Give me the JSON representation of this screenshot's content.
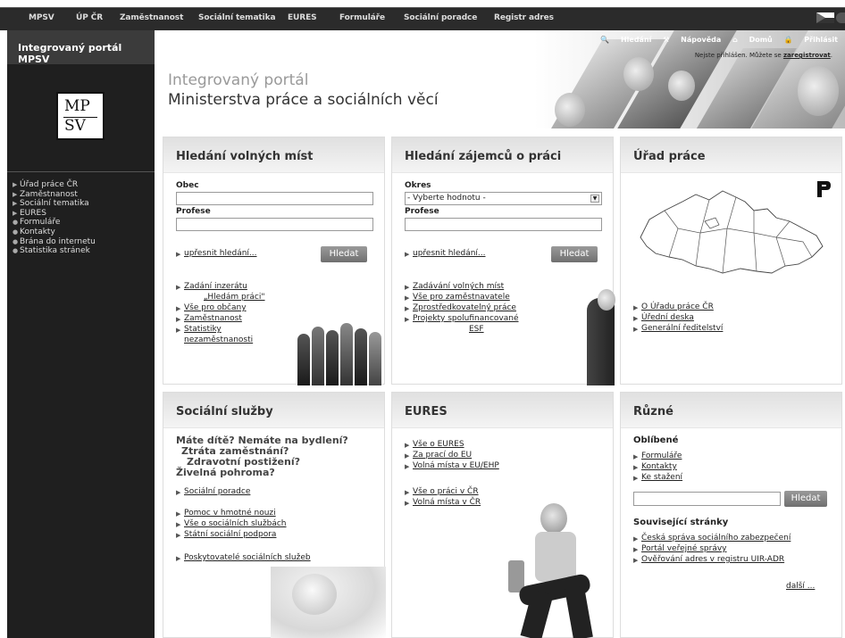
{
  "top_nav": [
    "MPSV",
    "ÚP ČR",
    "Zaměstnanost",
    "Sociální tematika",
    "EURES",
    "Formuláře",
    "Sociální poradce",
    "Registr adres"
  ],
  "sidebar": {
    "title": "Integrovaný portál MPSV",
    "logo_top": "MP",
    "logo_bottom": "SV",
    "menu": [
      "Úřad práce ČR",
      "Zaměstnanost",
      "Sociální tematika",
      "EURES",
      "Formuláře",
      "Kontakty",
      "Brána do internetu",
      "Statistika stránek"
    ]
  },
  "header": {
    "subtitle": "Integrovaný portál",
    "title": "Ministerstva práce a sociálních věcí",
    "search": "Hledání",
    "help": "Nápověda",
    "home": "Domů",
    "login": "Přihlásit",
    "login_note": "Nejste přihlášen. Můžete se",
    "register": "zaregistrovat"
  },
  "panel_jobs": {
    "title": "Hledání volných míst",
    "obec_label": "Obec",
    "profese_label": "Profese",
    "refine": "upřesnit hledání...",
    "search_button": "Hledat",
    "links": [
      "Zadání inzerátu",
      "„Hledám práci\"",
      "Vše pro občany",
      "Zaměstnanost",
      "Statistiky",
      "nezaměstnanosti"
    ]
  },
  "panel_candidates": {
    "title": "Hledání zájemců o práci",
    "okres_label": "Okres",
    "okres_value": "- Vyberte hodnotu -",
    "profese_label": "Profese",
    "refine": "upřesnit hledání...",
    "search_button": "Hledat",
    "links": [
      "Zadávání volných míst",
      "Vše pro zaměstnavatele",
      "Zprostředkovatelný práce",
      "Projekty spolufinancované",
      "ESF"
    ]
  },
  "panel_office": {
    "title": "Úřad práce",
    "links": [
      "O Úřadu práce ČR",
      "Úřední deska",
      "Generální ředitelství"
    ]
  },
  "panel_social": {
    "title": "Sociální služby",
    "questions": [
      "Máte dítě? Nemáte na bydlení?",
      "Ztráta zaměstnání?",
      "Zdravotní postižení?",
      "Živelná pohroma?"
    ],
    "links": [
      "Sociální poradce",
      "Pomoc v hmotné nouzi",
      "Vše o sociálních službách",
      "Státní sociální podpora",
      "Poskytovatelé sociálních služeb"
    ]
  },
  "panel_eures": {
    "title": "EURES",
    "links": [
      "Vše o EURES",
      "Za prací do EU",
      "Volná místa v EU/EHP",
      "Vše o práci v ČR",
      "Volná místa v ČR"
    ]
  },
  "panel_misc": {
    "title": "Různé",
    "favorites_heading": "Oblíbené",
    "favorites": [
      "Formuláře",
      "Kontakty",
      "Ke stažení"
    ],
    "search_button": "Hledat",
    "related_heading": "Související stránky",
    "related": [
      "Česká správa sociálního zabezpečení",
      "Portál veřejné správy",
      "Ověřování adres v registru UIR-ADR"
    ],
    "more": "další ..."
  }
}
